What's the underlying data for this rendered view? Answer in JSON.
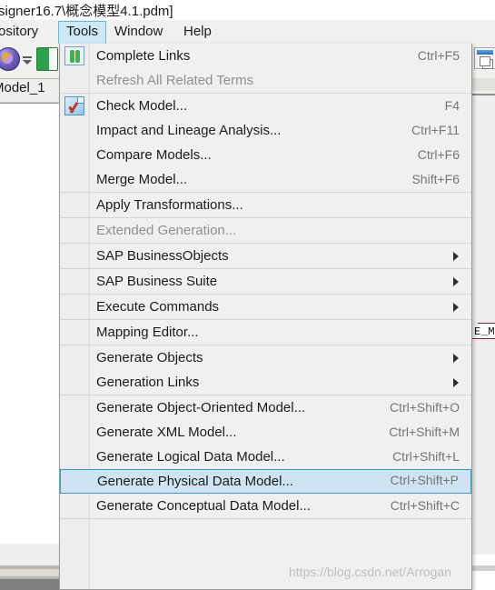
{
  "window": {
    "title": "signer16.7\\概念模型4.1.pdm]"
  },
  "menubar": {
    "items": [
      {
        "label": "ository",
        "name": "repository",
        "active": false
      },
      {
        "label": "Tools",
        "name": "tools",
        "active": true
      },
      {
        "label": "Window",
        "name": "window",
        "active": false
      },
      {
        "label": "Help",
        "name": "help",
        "active": false
      }
    ]
  },
  "workspace": {
    "tab_label": "Model_1",
    "entity_label": "E_MAN"
  },
  "toolbar": {
    "left_icons": [
      "globe-icon",
      "dropdown-arrow-icon",
      "book-icon"
    ],
    "right_icon": "window-cascade-icon"
  },
  "menu": {
    "name": "tools-menu",
    "items": [
      {
        "label": "Complete Links",
        "shortcut": "Ctrl+F5",
        "icon": "refresh-arrows-icon",
        "disabled": false,
        "submenu": false,
        "selected": false,
        "sep_after": false
      },
      {
        "label": "Refresh All Related Terms",
        "shortcut": "",
        "icon": "",
        "disabled": true,
        "submenu": false,
        "selected": false,
        "sep_after": true
      },
      {
        "label": "Check Model...",
        "shortcut": "F4",
        "icon": "check-model-icon",
        "disabled": false,
        "submenu": false,
        "selected": false,
        "sep_after": false
      },
      {
        "label": "Impact and Lineage Analysis...",
        "shortcut": "Ctrl+F11",
        "icon": "",
        "disabled": false,
        "submenu": false,
        "selected": false,
        "sep_after": false
      },
      {
        "label": "Compare Models...",
        "shortcut": "Ctrl+F6",
        "icon": "",
        "disabled": false,
        "submenu": false,
        "selected": false,
        "sep_after": false
      },
      {
        "label": "Merge Model...",
        "shortcut": "Shift+F6",
        "icon": "",
        "disabled": false,
        "submenu": false,
        "selected": false,
        "sep_after": true
      },
      {
        "label": "Apply Transformations...",
        "shortcut": "",
        "icon": "",
        "disabled": false,
        "submenu": false,
        "selected": false,
        "sep_after": true
      },
      {
        "label": "Extended Generation...",
        "shortcut": "",
        "icon": "",
        "disabled": true,
        "submenu": false,
        "selected": false,
        "sep_after": true
      },
      {
        "label": "SAP BusinessObjects",
        "shortcut": "",
        "icon": "",
        "disabled": false,
        "submenu": true,
        "selected": false,
        "sep_after": true
      },
      {
        "label": "SAP Business Suite",
        "shortcut": "",
        "icon": "",
        "disabled": false,
        "submenu": true,
        "selected": false,
        "sep_after": true
      },
      {
        "label": "Execute Commands",
        "shortcut": "",
        "icon": "",
        "disabled": false,
        "submenu": true,
        "selected": false,
        "sep_after": true
      },
      {
        "label": "Mapping Editor...",
        "shortcut": "",
        "icon": "",
        "disabled": false,
        "submenu": false,
        "selected": false,
        "sep_after": true
      },
      {
        "label": "Generate Objects",
        "shortcut": "",
        "icon": "",
        "disabled": false,
        "submenu": true,
        "selected": false,
        "sep_after": false
      },
      {
        "label": "Generation Links",
        "shortcut": "",
        "icon": "",
        "disabled": false,
        "submenu": true,
        "selected": false,
        "sep_after": true
      },
      {
        "label": "Generate Object-Oriented Model...",
        "shortcut": "Ctrl+Shift+O",
        "icon": "",
        "disabled": false,
        "submenu": false,
        "selected": false,
        "sep_after": false
      },
      {
        "label": "Generate XML Model...",
        "shortcut": "Ctrl+Shift+M",
        "icon": "",
        "disabled": false,
        "submenu": false,
        "selected": false,
        "sep_after": false
      },
      {
        "label": "Generate Logical Data Model...",
        "shortcut": "Ctrl+Shift+L",
        "icon": "",
        "disabled": false,
        "submenu": false,
        "selected": false,
        "sep_after": false
      },
      {
        "label": "Generate Physical Data Model...",
        "shortcut": "Ctrl+Shift+P",
        "icon": "",
        "disabled": false,
        "submenu": false,
        "selected": true,
        "sep_after": false
      },
      {
        "label": "Generate Conceptual Data Model...",
        "shortcut": "Ctrl+Shift+C",
        "icon": "",
        "disabled": false,
        "submenu": false,
        "selected": false,
        "sep_after": true
      }
    ]
  },
  "watermark": {
    "text": "https://blog.csdn.net/Arrogan"
  },
  "colors": {
    "menu_bg": "#f0f0f0",
    "selected_fill": "#cfe4f2",
    "selected_border": "#3d9ad0",
    "menubar_active_fill": "#cde8f6",
    "disabled_text": "#8f8f8f",
    "shortcut_text": "#757575"
  }
}
